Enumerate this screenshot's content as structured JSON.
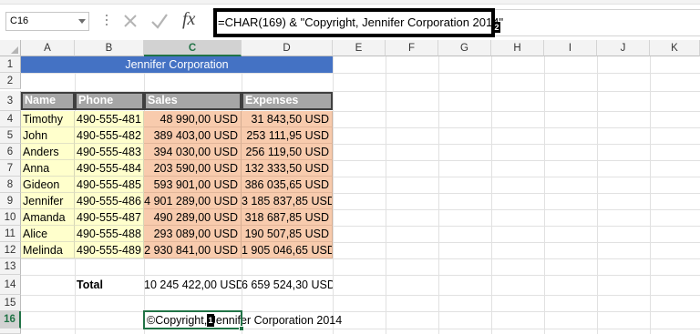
{
  "name_box": {
    "value": "C16"
  },
  "formula_bar": {
    "fx_label": "fx",
    "formula": "=CHAR(169) & \"Copyright, Jennifer Corporation 2014\"",
    "badge": "2"
  },
  "columns": [
    "A",
    "B",
    "C",
    "D",
    "E",
    "F",
    "G",
    "H",
    "I",
    "J",
    "K"
  ],
  "selected_column": "C",
  "rows": [
    "1",
    "2",
    "3",
    "4",
    "5",
    "6",
    "7",
    "8",
    "9",
    "10",
    "11",
    "12",
    "13",
    "14",
    "15",
    "16"
  ],
  "selected_row": "16",
  "sheet": {
    "title": "Jennifer Corporation",
    "headers": {
      "name": "Name",
      "phone": "Phone",
      "sales": "Sales",
      "expenses": "Expenses"
    },
    "records": [
      {
        "name": "Timothy",
        "phone": "490-555-481",
        "sales": "48 990,00 USD",
        "expenses": "31 843,50 USD"
      },
      {
        "name": "John",
        "phone": "490-555-482",
        "sales": "389 403,00 USD",
        "expenses": "253 111,95 USD"
      },
      {
        "name": "Anders",
        "phone": "490-555-483",
        "sales": "394 030,00 USD",
        "expenses": "256 119,50 USD"
      },
      {
        "name": "Anna",
        "phone": "490-555-484",
        "sales": "203 590,00 USD",
        "expenses": "132 333,50 USD"
      },
      {
        "name": "Gideon",
        "phone": "490-555-485",
        "sales": "593 901,00 USD",
        "expenses": "386 035,65 USD"
      },
      {
        "name": "Jennifer",
        "phone": "490-555-486",
        "sales": "4 901 289,00 USD",
        "expenses": "3 185 837,85 USD"
      },
      {
        "name": "Amanda",
        "phone": "490-555-487",
        "sales": "490 289,00 USD",
        "expenses": "318 687,85 USD"
      },
      {
        "name": "Alice",
        "phone": "490-555-488",
        "sales": "293 089,00 USD",
        "expenses": "190 507,85 USD"
      },
      {
        "name": "Melinda",
        "phone": "490-555-489",
        "sales": "2 930 841,00 USD",
        "expenses": "1 905 046,65 USD"
      }
    ],
    "total": {
      "label": "Total",
      "sales": "10 245 422,00 USD",
      "expenses": "6 659 524,30 USD"
    },
    "c16": {
      "value": "©Copyright, Jennifer Corporation 2014",
      "badge": "1"
    }
  },
  "colors": {
    "title_fill": "#4472c4",
    "header_fill": "#a6a6a6",
    "name_fill": "#ffffcc",
    "data_fill": "#f8cbad",
    "selection": "#217346"
  },
  "icons": [
    "dropdown-caret-icon",
    "cancel-x-icon",
    "enter-check-icon",
    "insert-function-icon",
    "select-all-triangle-icon"
  ]
}
